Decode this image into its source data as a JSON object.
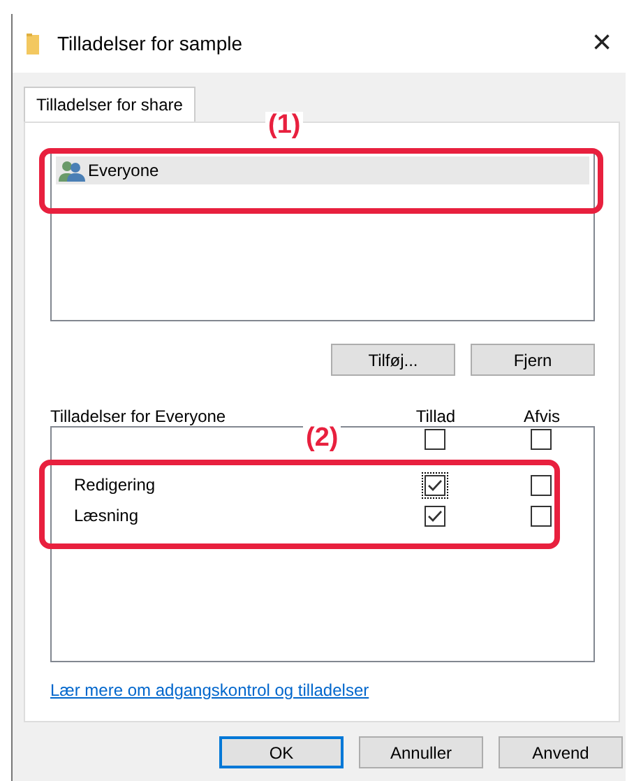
{
  "window": {
    "title": "Tilladelser for sample",
    "close": "×"
  },
  "tabs": [
    {
      "label": "Tilladelser for share",
      "selected": true
    }
  ],
  "groups": [
    {
      "name": "Everyone",
      "selected": true
    }
  ],
  "group_buttons": [
    "Tilføj...",
    "Fjern"
  ],
  "permissions": {
    "heading": "Tilladelser for Everyone",
    "allow_header": "Tillad",
    "deny_header": "Afvis",
    "rows": [
      {
        "allow": false,
        "deny": false,
        "focused": false
      },
      {
        "label": "Redigering",
        "allow": true,
        "deny": false,
        "focused": true
      },
      {
        "label": "Læsning",
        "allow": true,
        "deny": false,
        "focused": false
      }
    ]
  },
  "link": "Lær mere om adgangskontrol og tilladelser",
  "buttons": [
    {
      "label": "OK",
      "default": true
    },
    {
      "label": "Annuller",
      "default": false
    },
    {
      "label": "Anvend",
      "default": false
    }
  ],
  "callouts": [
    {
      "label": "(1)"
    },
    {
      "label": "(2)"
    }
  ]
}
